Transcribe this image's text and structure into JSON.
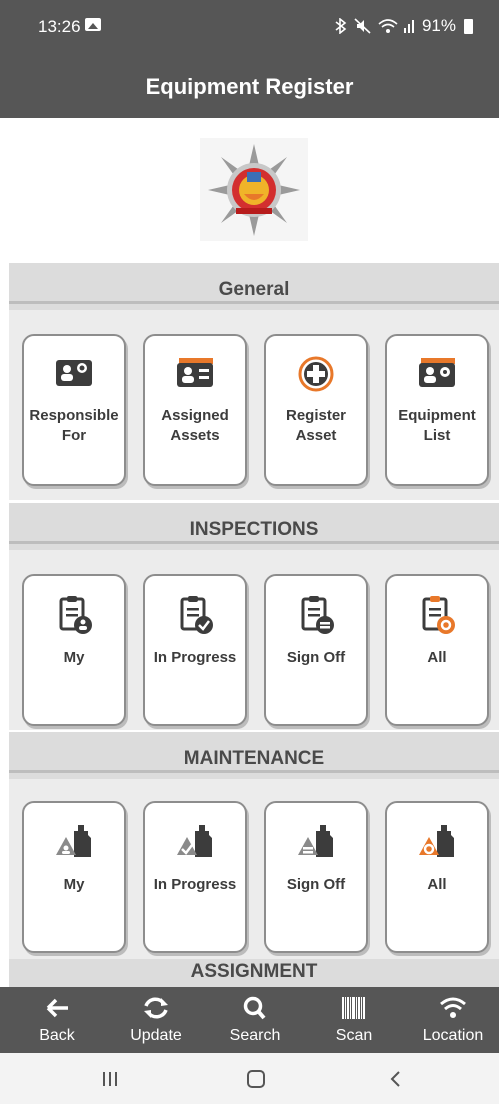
{
  "status_bar": {
    "time": "13:26",
    "battery": "91%"
  },
  "header": {
    "title": "Equipment Register"
  },
  "sections": [
    {
      "title": "General",
      "tiles": [
        {
          "label": "Responsible For",
          "icon": "id-card-tag-icon"
        },
        {
          "label": "Assigned Assets",
          "icon": "id-card-list-icon"
        },
        {
          "label": "Register Asset",
          "icon": "plus-circle-icon"
        },
        {
          "label": "Equipment List",
          "icon": "id-card-gear-icon"
        }
      ]
    },
    {
      "title": "INSPECTIONS",
      "tiles": [
        {
          "label": "My",
          "icon": "clipboard-user-icon"
        },
        {
          "label": "In Progress",
          "icon": "clipboard-check-icon"
        },
        {
          "label": "Sign Off",
          "icon": "clipboard-minus-icon"
        },
        {
          "label": "All",
          "icon": "clipboard-gear-icon"
        }
      ]
    },
    {
      "title": "MAINTENANCE",
      "tiles": [
        {
          "label": "My",
          "icon": "oil-can-user-icon"
        },
        {
          "label": "In Progress",
          "icon": "oil-can-check-icon"
        },
        {
          "label": "Sign Off",
          "icon": "oil-can-minus-icon"
        },
        {
          "label": "All",
          "icon": "oil-can-gear-icon"
        }
      ]
    },
    {
      "title": "ASSIGNMENT"
    }
  ],
  "bottom_nav": [
    {
      "label": "Back",
      "icon": "arrow-left-icon"
    },
    {
      "label": "Update",
      "icon": "refresh-icon"
    },
    {
      "label": "Search",
      "icon": "search-icon"
    },
    {
      "label": "Scan",
      "icon": "barcode-icon"
    },
    {
      "label": "Location",
      "icon": "wifi-icon"
    }
  ],
  "colors": {
    "bar": "#565656",
    "accent": "#e8782a",
    "icon_dark": "#3c3c3c",
    "section_bg": "#dcdcdc"
  }
}
